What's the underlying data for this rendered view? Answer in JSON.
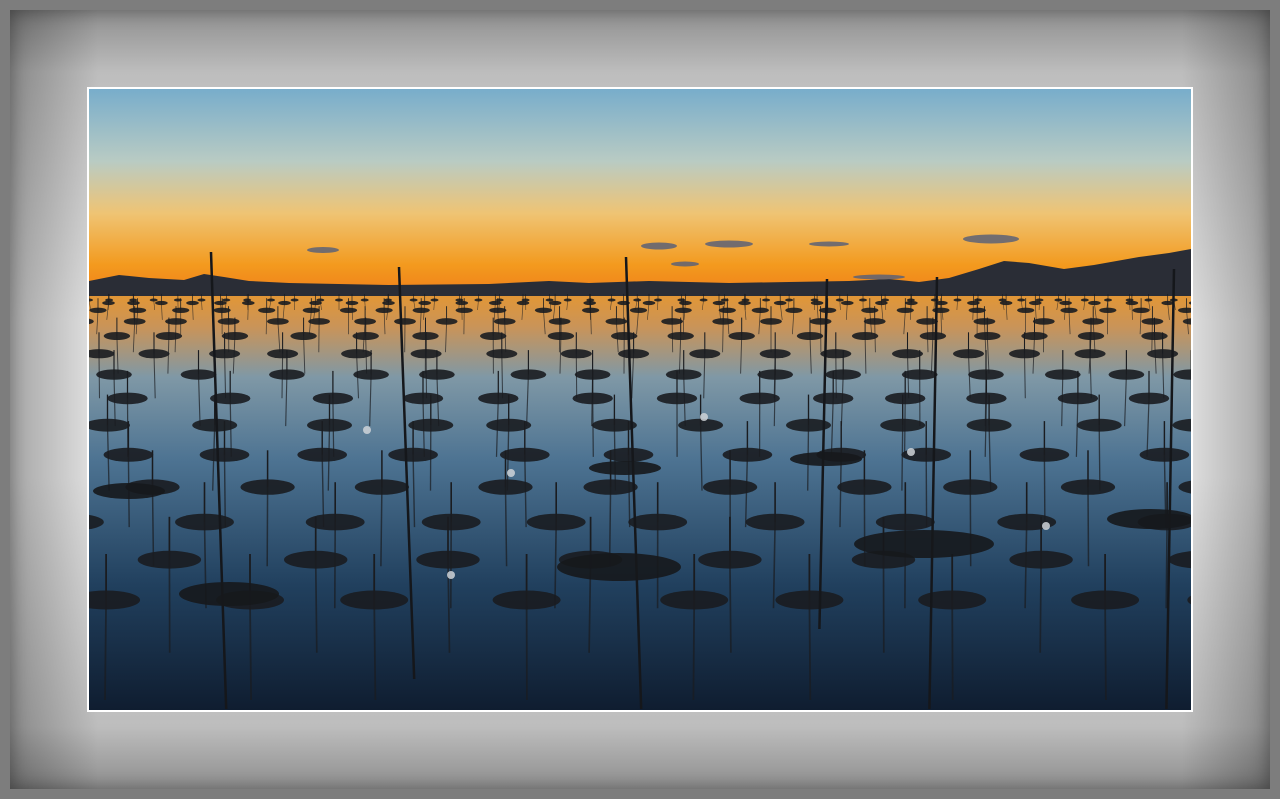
{
  "image": {
    "description_colors": {
      "sky_top": "#7fb3cf",
      "sky_mid": "#cfd0b8",
      "horizon_glow": "#f39a1e",
      "water_top": "#e8a94a",
      "water_deep": "#0e1a2a",
      "silhouette": "#1b1d22"
    }
  }
}
